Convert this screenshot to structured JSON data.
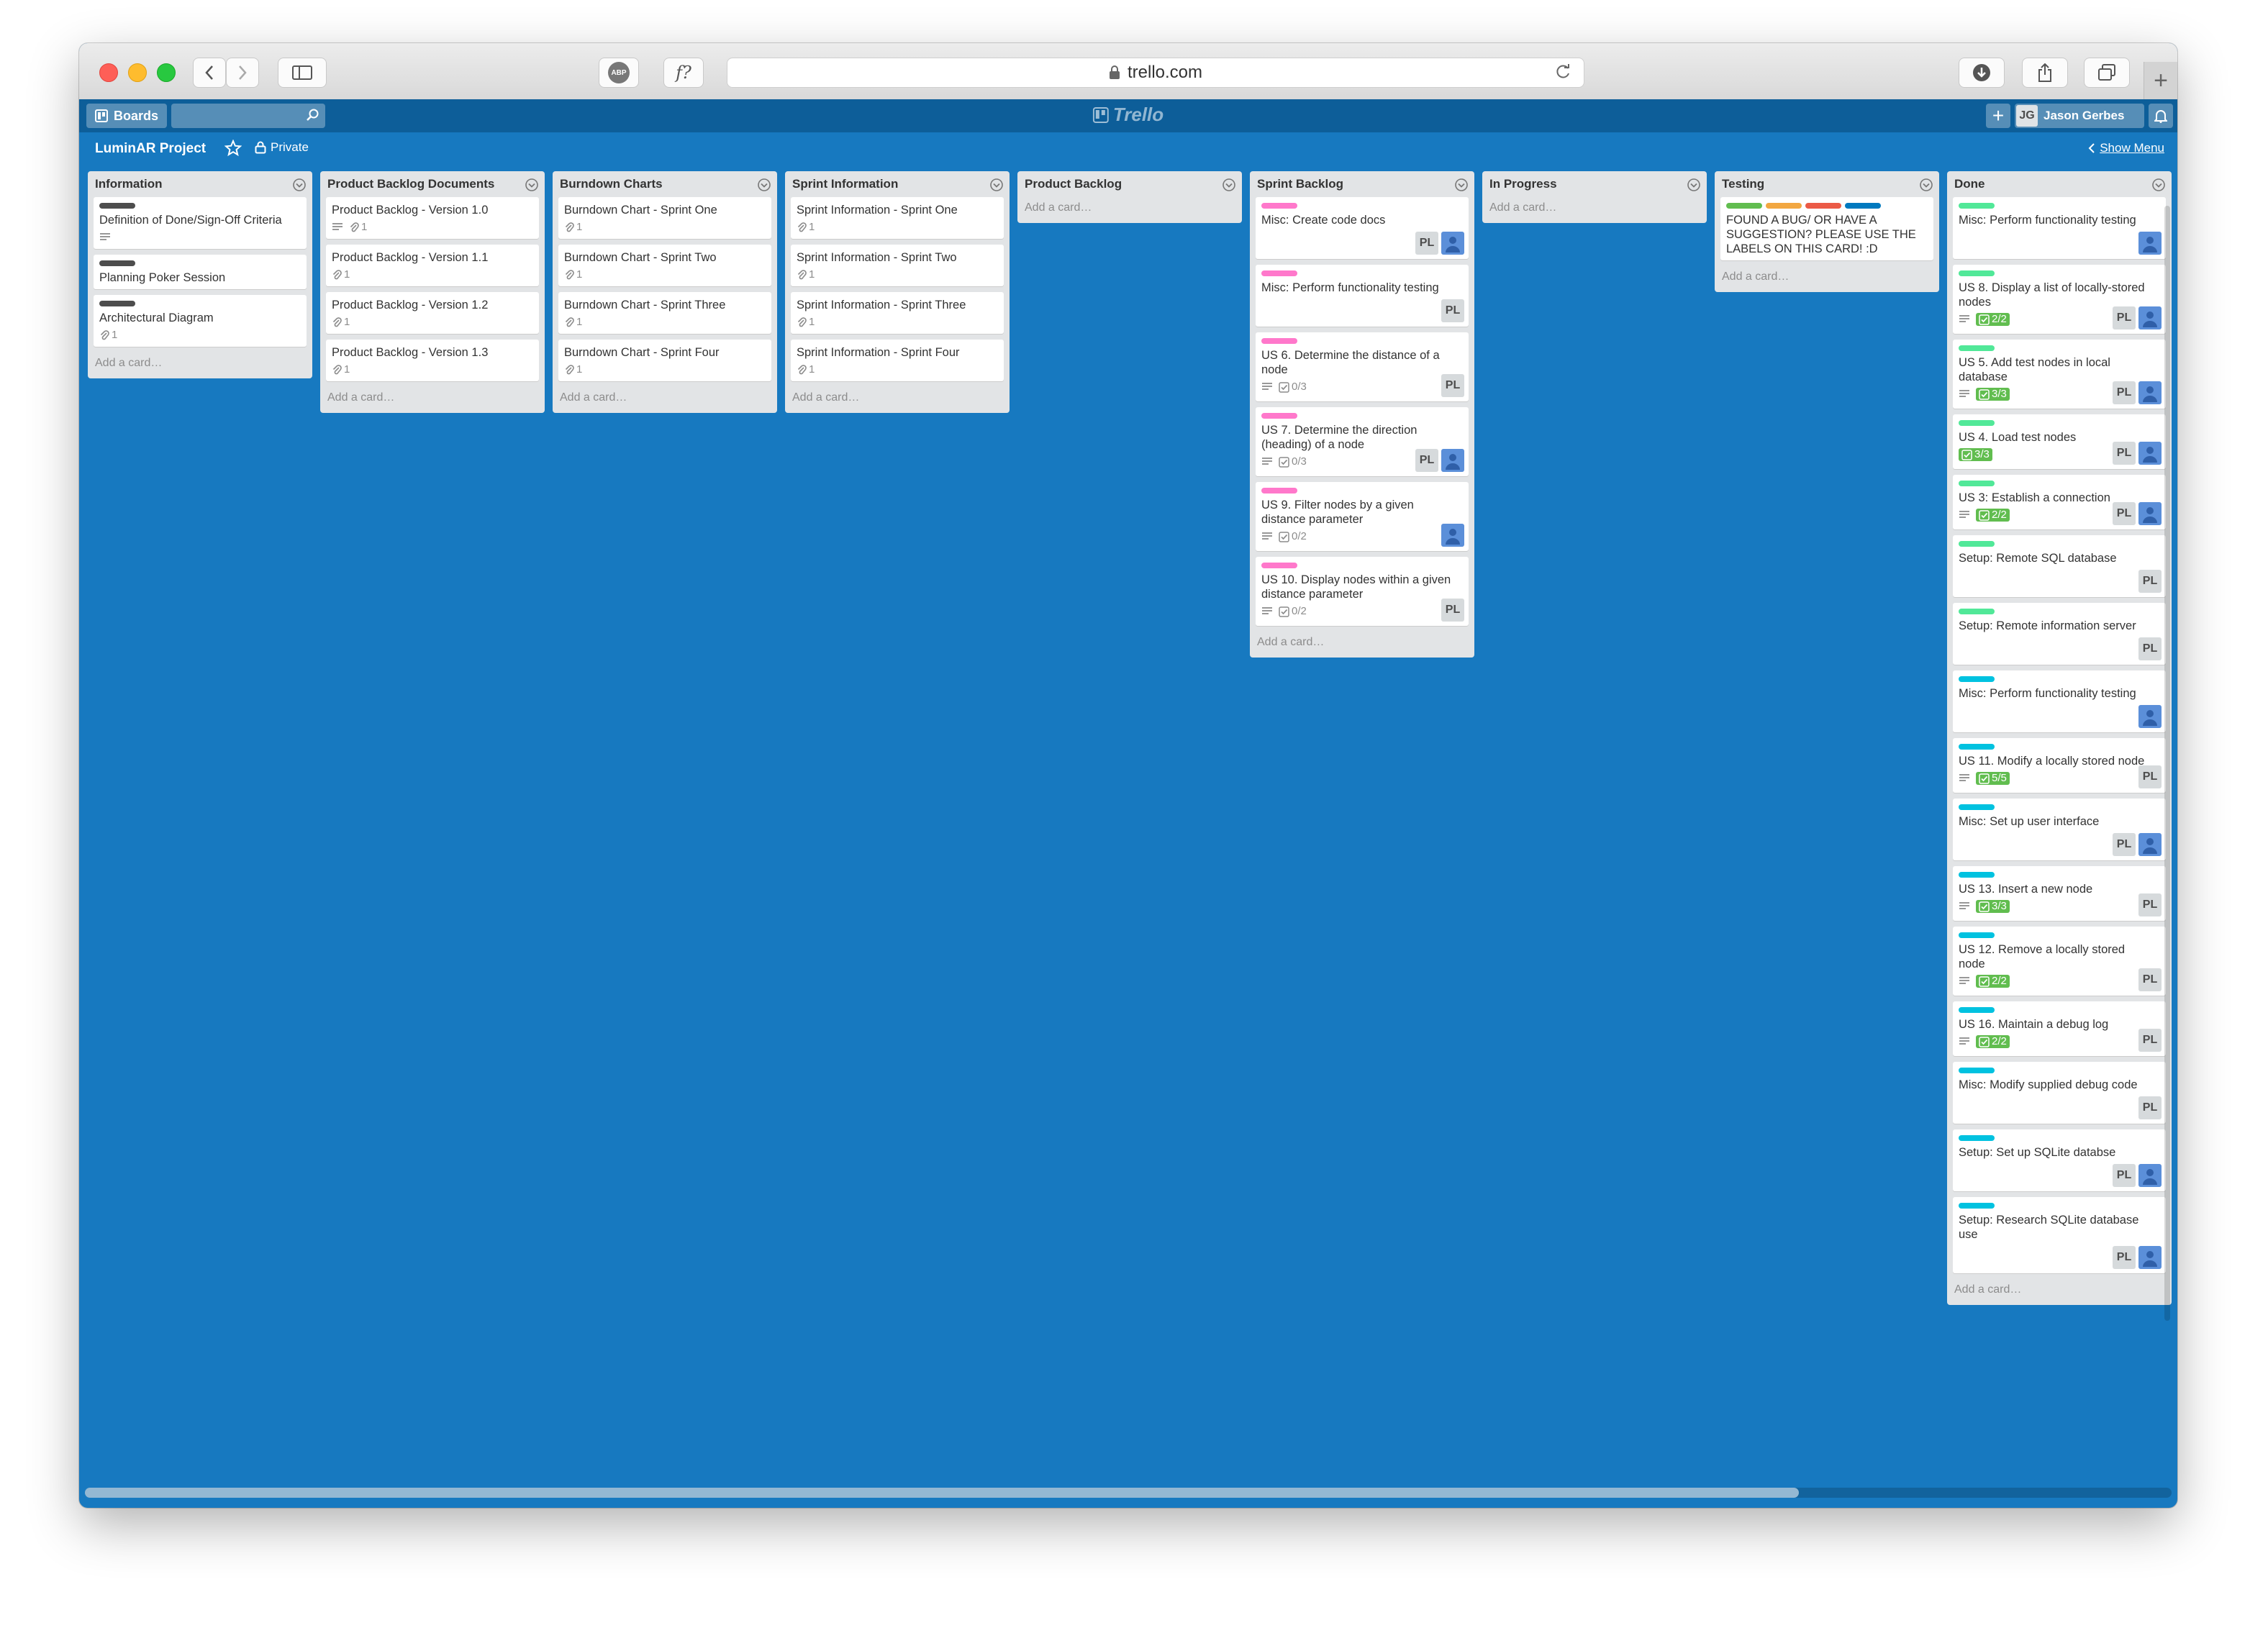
{
  "browser": {
    "url": "trello.com",
    "adblock_label": "ABP",
    "formula_label": "f?"
  },
  "header": {
    "boards_label": "Boards",
    "logo_text": "Trello",
    "user_initials": "JG",
    "user_name": "Jason Gerbes"
  },
  "board": {
    "title": "LuminAR Project",
    "visibility": "Private",
    "show_menu": "Show Menu",
    "add_card": "Add a card…"
  },
  "colors": {
    "board_bg": "#1779c0",
    "header_bg": "#0d5e99",
    "green": "#61bd4f",
    "yellow": "#f2a741",
    "red": "#eb5a46",
    "blue": "#0079bf",
    "pink": "#ff78cb",
    "lime": "#51e898",
    "sky": "#00c2e0",
    "black": "#4d4d4d"
  },
  "lists": [
    {
      "name": "Information",
      "cards": [
        {
          "title": "Definition of Done/Sign-Off Criteria",
          "labels": [
            "black"
          ],
          "desc": true
        },
        {
          "title": "Planning Poker Session",
          "labels": [
            "black"
          ]
        },
        {
          "title": "Architectural Diagram",
          "labels": [
            "black"
          ],
          "attach": "1"
        }
      ]
    },
    {
      "name": "Product Backlog Documents",
      "cards": [
        {
          "title": "Product Backlog - Version 1.0",
          "desc": true,
          "attach": "1"
        },
        {
          "title": "Product Backlog - Version 1.1",
          "attach": "1"
        },
        {
          "title": "Product Backlog - Version 1.2",
          "attach": "1"
        },
        {
          "title": "Product Backlog - Version 1.3",
          "attach": "1"
        }
      ]
    },
    {
      "name": "Burndown Charts",
      "cards": [
        {
          "title": "Burndown Chart - Sprint One",
          "attach": "1"
        },
        {
          "title": "Burndown Chart - Sprint Two",
          "attach": "1"
        },
        {
          "title": "Burndown Chart - Sprint Three",
          "attach": "1"
        },
        {
          "title": "Burndown Chart - Sprint Four",
          "attach": "1"
        }
      ]
    },
    {
      "name": "Sprint Information",
      "cards": [
        {
          "title": "Sprint Information - Sprint One",
          "attach": "1"
        },
        {
          "title": "Sprint Information - Sprint Two",
          "attach": "1"
        },
        {
          "title": "Sprint Information - Sprint Three",
          "attach": "1"
        },
        {
          "title": "Sprint Information - Sprint Four",
          "attach": "1"
        }
      ]
    },
    {
      "name": "Product Backlog",
      "cards": []
    },
    {
      "name": "Sprint Backlog",
      "cards": [
        {
          "title": "Misc: Create code docs",
          "labels": [
            "pink"
          ],
          "members": [
            "PL",
            "avatar"
          ]
        },
        {
          "title": "Misc: Perform functionality testing",
          "labels": [
            "pink"
          ],
          "members": [
            "PL"
          ]
        },
        {
          "title": "US 6. Determine the distance of a node",
          "labels": [
            "pink"
          ],
          "desc": true,
          "check": "0/3",
          "members": [
            "PL"
          ]
        },
        {
          "title": "US 7. Determine the direction (heading) of a node",
          "labels": [
            "pink"
          ],
          "desc": true,
          "check": "0/3",
          "members": [
            "PL",
            "avatar"
          ]
        },
        {
          "title": "US 9. Filter nodes by a given distance parameter",
          "labels": [
            "pink"
          ],
          "desc": true,
          "check": "0/2",
          "members": [
            "avatar"
          ]
        },
        {
          "title": "US 10. Display nodes within a given distance parameter",
          "labels": [
            "pink"
          ],
          "desc": true,
          "check": "0/2",
          "members": [
            "PL"
          ]
        }
      ]
    },
    {
      "name": "In Progress",
      "cards": []
    },
    {
      "name": "Testing",
      "cards": [
        {
          "title": "FOUND A BUG/ OR HAVE A SUGGESTION? PLEASE USE THE LABELS ON THIS CARD! :D",
          "labels": [
            "green",
            "yellow",
            "red",
            "blue"
          ]
        }
      ]
    },
    {
      "name": "Done",
      "cards": [
        {
          "title": "Misc: Perform functionality testing",
          "labels": [
            "lime"
          ],
          "members": [
            "avatar"
          ]
        },
        {
          "title": "US 8. Display a list of locally-stored nodes",
          "labels": [
            "lime"
          ],
          "desc": true,
          "check": "2/2",
          "check_done": true,
          "members": [
            "PL",
            "avatar"
          ]
        },
        {
          "title": "US 5. Add test nodes in local database",
          "labels": [
            "lime"
          ],
          "desc": true,
          "check": "3/3",
          "check_done": true,
          "members": [
            "PL",
            "avatar"
          ]
        },
        {
          "title": "US 4. Load test nodes",
          "labels": [
            "lime"
          ],
          "check": "3/3",
          "check_done": true,
          "members": [
            "PL",
            "avatar"
          ]
        },
        {
          "title": "US 3: Establish a connection",
          "labels": [
            "lime"
          ],
          "desc": true,
          "check": "2/2",
          "check_done": true,
          "members": [
            "PL",
            "avatar"
          ]
        },
        {
          "title": "Setup: Remote SQL database",
          "labels": [
            "lime"
          ],
          "members": [
            "PL"
          ]
        },
        {
          "title": "Setup: Remote information server",
          "labels": [
            "lime"
          ],
          "members": [
            "PL"
          ]
        },
        {
          "title": "Misc: Perform functionality testing",
          "labels": [
            "sky"
          ],
          "members": [
            "avatar"
          ]
        },
        {
          "title": "US 11. Modify a locally stored node",
          "labels": [
            "sky"
          ],
          "desc": true,
          "check": "5/5",
          "check_done": true,
          "members": [
            "PL"
          ]
        },
        {
          "title": "Misc: Set up user interface",
          "labels": [
            "sky"
          ],
          "members": [
            "PL",
            "avatar"
          ]
        },
        {
          "title": "US 13. Insert a new node",
          "labels": [
            "sky"
          ],
          "desc": true,
          "check": "3/3",
          "check_done": true,
          "members": [
            "PL"
          ]
        },
        {
          "title": "US 12. Remove a locally stored node",
          "labels": [
            "sky"
          ],
          "desc": true,
          "check": "2/2",
          "check_done": true,
          "members": [
            "PL"
          ]
        },
        {
          "title": "US 16. Maintain a debug log",
          "labels": [
            "sky"
          ],
          "desc": true,
          "check": "2/2",
          "check_done": true,
          "members": [
            "PL"
          ]
        },
        {
          "title": "Misc: Modify supplied debug code",
          "labels": [
            "sky"
          ],
          "members": [
            "PL"
          ]
        },
        {
          "title": "Setup: Set up SQLite databse",
          "labels": [
            "sky"
          ],
          "members": [
            "PL",
            "avatar"
          ]
        },
        {
          "title": "Setup: Research SQLite database use",
          "labels": [
            "sky"
          ],
          "members": [
            "PL",
            "avatar"
          ]
        }
      ]
    }
  ]
}
